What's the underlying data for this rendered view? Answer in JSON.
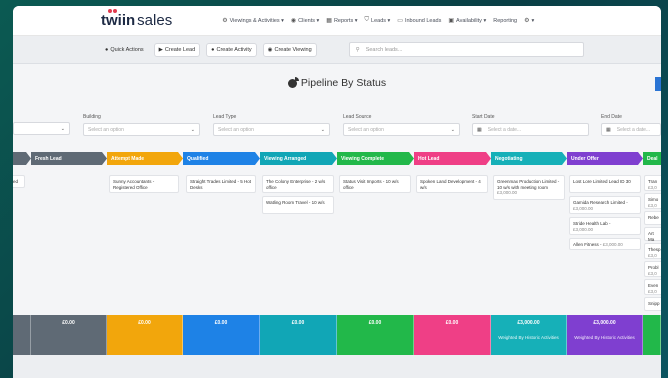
{
  "app": {
    "logo_bold": "twiin",
    "logo_light": "sales"
  },
  "nav": [
    {
      "icon": "⚙",
      "label": "Viewings & Activities ▾"
    },
    {
      "icon": "◉",
      "label": "Clients ▾"
    },
    {
      "icon": "▦",
      "label": "Reports ▾"
    },
    {
      "icon": "⛉",
      "label": "Leads ▾"
    },
    {
      "icon": "▭",
      "label": "Inbound Leads"
    },
    {
      "icon": "▣",
      "label": "Availability ▾"
    },
    {
      "icon": "",
      "label": "Reporting"
    },
    {
      "icon": "⚙",
      "label": "▾"
    }
  ],
  "quick_actions": {
    "title": "Quick Actions",
    "buttons": [
      "Create Lead",
      "Create Activity",
      "Create Viewing"
    ]
  },
  "search": {
    "placeholder": "Search leads..."
  },
  "page_title": "Pipeline By Status",
  "filters": [
    {
      "label": "",
      "placeholder": ""
    },
    {
      "label": "Building",
      "placeholder": "Select an option"
    },
    {
      "label": "Lead Type",
      "placeholder": "Select an option"
    },
    {
      "label": "Lead Source",
      "placeholder": "Select an option"
    },
    {
      "label": "Start Date",
      "placeholder": "Select a date..."
    },
    {
      "label": "End Date",
      "placeholder": "Select a date..."
    }
  ],
  "stages": [
    {
      "label": "",
      "color": "#5f6a75"
    },
    {
      "label": "Fresh Lead",
      "color": "#5f6a75"
    },
    {
      "label": "Attempt Made",
      "color": "#f2a60c"
    },
    {
      "label": "Qualified",
      "color": "#1e82e6"
    },
    {
      "label": "Viewing Arranged",
      "color": "#11a6b6"
    },
    {
      "label": "Viewing Complete",
      "color": "#22b84a"
    },
    {
      "label": "Hot Lead",
      "color": "#ef3f86"
    },
    {
      "label": "Negotiating",
      "color": "#16b0b8"
    },
    {
      "label": "Under Offer",
      "color": "#7f3fd0"
    },
    {
      "label": "Deal",
      "color": "#22b84a"
    }
  ],
  "cards": [
    {
      "title": "ed",
      "sub": ""
    },
    {
      "title": "Sunny Accountants - Registered Office",
      "sub": ""
    },
    {
      "title": "Straight Trades Limited - 5 Hot Desks",
      "sub": ""
    },
    {
      "title": "The Colony Enterprise - 2 w/s office",
      "sub": ""
    },
    {
      "title": "Watling Room Travel - 10 w/s",
      "sub": ""
    },
    {
      "title": "Status Visit Imports - 10 w/s office",
      "sub": ""
    },
    {
      "title": "Spoken Land Development - 4 w/s",
      "sub": ""
    },
    {
      "title": "Greenmax Production Limited - 10 w/s with meeting room",
      "sub": "£3,000.00"
    },
    {
      "title": "Lost Lore Limited Lead ID 30",
      "sub": ""
    },
    {
      "title": "Gamida Research Limited -",
      "sub": "£3,000.00"
    },
    {
      "title": "Stride Health Lab -",
      "sub": "£3,000.00"
    },
    {
      "title": "Allen Fitness -",
      "sub": "£3,000.00"
    },
    {
      "title": "Tran",
      "sub": "£3,0"
    },
    {
      "title": "Simo",
      "sub": "£3,0"
    },
    {
      "title": "Rebe",
      "sub": ""
    },
    {
      "title": "Art Ma",
      "sub": ""
    },
    {
      "title": "Thesp",
      "sub": "£3,0"
    },
    {
      "title": "Probl",
      "sub": "£3,0"
    },
    {
      "title": "Even",
      "sub": "£3,0"
    },
    {
      "title": "Snipp",
      "sub": ""
    }
  ],
  "footer": [
    {
      "value": "",
      "sub": ""
    },
    {
      "value": "£0.00",
      "sub": ""
    },
    {
      "value": "£0.00",
      "sub": ""
    },
    {
      "value": "£0.00",
      "sub": ""
    },
    {
      "value": "£0.00",
      "sub": ""
    },
    {
      "value": "£0.00",
      "sub": ""
    },
    {
      "value": "£0.00",
      "sub": ""
    },
    {
      "value": "£3,000.00",
      "sub": "Weighted By Historic Activities"
    },
    {
      "value": "£3,000.00",
      "sub": "Weighted By Historic Activities"
    },
    {
      "value": "",
      "sub": ""
    }
  ]
}
